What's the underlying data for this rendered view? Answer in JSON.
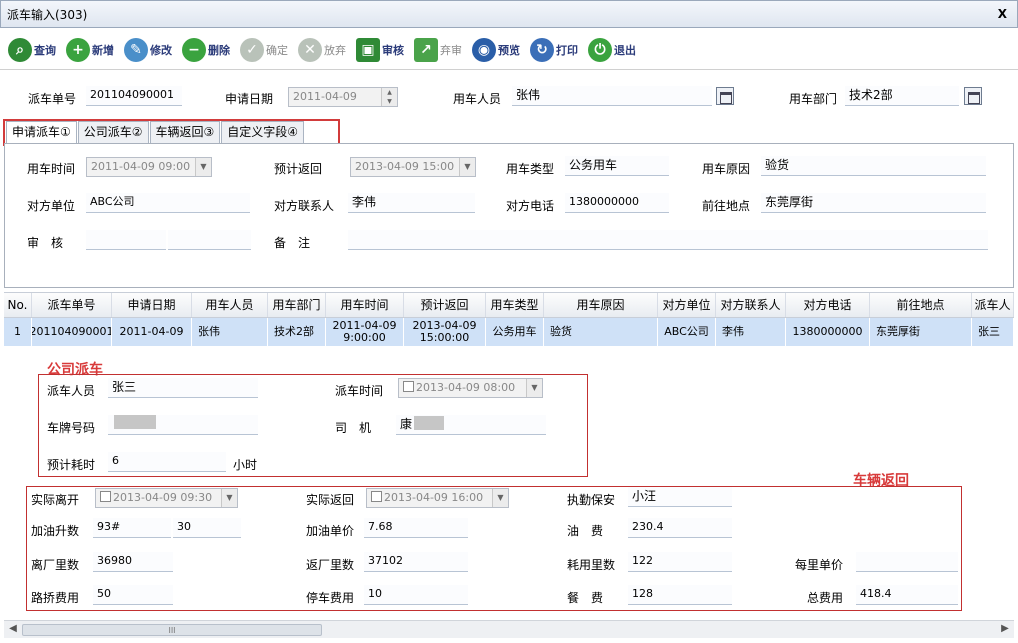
{
  "window": {
    "title": "派车输入(303)",
    "close": "X"
  },
  "toolbar": [
    {
      "name": "query",
      "label": "查询",
      "icon": "search-icon",
      "glyph": "⌕",
      "color": "#2f8a36",
      "enabled": true
    },
    {
      "name": "new",
      "label": "新增",
      "icon": "add-icon",
      "glyph": "+",
      "color": "#3aa33f",
      "enabled": true
    },
    {
      "name": "edit",
      "label": "修改",
      "icon": "pencil-icon",
      "glyph": "✎",
      "color": "#4a8fc9",
      "enabled": true
    },
    {
      "name": "delete",
      "label": "删除",
      "icon": "minus-icon",
      "glyph": "−",
      "color": "#3aa33f",
      "enabled": true
    },
    {
      "name": "confirm",
      "label": "确定",
      "icon": "check-icon",
      "glyph": "✓",
      "color": "#b9c2b9",
      "enabled": false
    },
    {
      "name": "abandon",
      "label": "放弃",
      "icon": "cancel-icon",
      "glyph": "✕",
      "color": "#b9c2b9",
      "enabled": false
    },
    {
      "name": "audit",
      "label": "审核",
      "icon": "audit-icon",
      "glyph": "▣",
      "color": "#2f8a36",
      "enabled": true
    },
    {
      "name": "unaudit",
      "label": "弃审",
      "icon": "unaudit-icon",
      "glyph": "↗",
      "color": "#4aa34a",
      "enabled": false
    },
    {
      "name": "preview",
      "label": "预览",
      "icon": "preview-icon",
      "glyph": "◉",
      "color": "#2a5ea8",
      "enabled": true
    },
    {
      "name": "print",
      "label": "打印",
      "icon": "print-icon",
      "glyph": "↻",
      "color": "#3b6fb8",
      "enabled": true
    },
    {
      "name": "exit",
      "label": "退出",
      "icon": "exit-icon",
      "glyph": "⏻",
      "color": "#3aa33f",
      "enabled": true
    }
  ],
  "header": {
    "order_no_label": "派车单号",
    "order_no": "201104090001",
    "apply_date_label": "申请日期",
    "apply_date": "2011-04-09",
    "user_label": "用车人员",
    "user": "张伟",
    "dept_label": "用车部门",
    "dept": "技术2部"
  },
  "tabs": [
    "申请派车①",
    "公司派车②",
    "车辆返回③",
    "自定义字段④"
  ],
  "apply": {
    "use_time_label": "用车时间",
    "use_time": "2011-04-09 09:00",
    "expect_return_label": "预计返回",
    "expect_return": "2013-04-09 15:00",
    "car_type_label": "用车类型",
    "car_type": "公务用车",
    "reason_label": "用车原因",
    "reason": "验货",
    "party_unit_label": "对方单位",
    "party_unit": "ABC公司",
    "party_contact_label": "对方联系人",
    "party_contact": "李伟",
    "party_phone_label": "对方电话",
    "party_phone": "1380000000",
    "destination_label": "前往地点",
    "destination": "东莞厚街",
    "auditor_label": "审　核",
    "remark_label": "备　注"
  },
  "grid": {
    "columns": [
      "No.",
      "派车单号",
      "申请日期",
      "用车人员",
      "用车部门",
      "用车时间",
      "预计返回",
      "用车类型",
      "用车原因",
      "对方单位",
      "对方联系人",
      "对方电话",
      "前往地点",
      "派车人"
    ],
    "row": {
      "no": "1",
      "order_no": "201104090001",
      "apply_date": "2011-04-09",
      "user": "张伟",
      "dept": "技术2部",
      "use_time_d": "2011-04-09",
      "use_time_t": "9:00:00",
      "return_d": "2013-04-09",
      "return_t": "15:00:00",
      "car_type": "公务用车",
      "reason": "验货",
      "party_unit": "ABC公司",
      "party_contact": "李伟",
      "party_phone": "1380000000",
      "destination": "东莞厚街",
      "dispatcher": "张三"
    }
  },
  "company_dispatch": {
    "section_title": "公司派车",
    "dispatcher_label": "派车人员",
    "dispatcher": "张三",
    "dispatch_time_label": "派车时间",
    "dispatch_time": "2013-04-09 08:00",
    "plate_label": "车牌号码",
    "driver_label": "司　机",
    "driver_prefix": "康",
    "expect_hours_label": "预计耗时",
    "expect_hours": "6",
    "hours_unit": "小时"
  },
  "car_return": {
    "section_title": "车辆返回",
    "actual_leave_label": "实际离开",
    "actual_leave": "2013-04-09 09:30",
    "actual_return_label": "实际返回",
    "actual_return": "2013-04-09 16:00",
    "guard_label": "执勤保安",
    "guard": "小汪",
    "fuel_amount_label": "加油升数",
    "fuel_grade": "93#",
    "fuel_amount": "30",
    "fuel_price_label": "加油单价",
    "fuel_price": "7.68",
    "fuel_fee_label": "油　费",
    "fuel_fee": "230.4",
    "leave_km_label": "离厂里数",
    "leave_km": "36980",
    "return_km_label": "返厂里数",
    "return_km": "37102",
    "used_km_label": "耗用里数",
    "used_km": "122",
    "per_km_price_label": "每里单价",
    "per_km_price": "",
    "toll_label": "路挢费用",
    "toll": "50",
    "parking_label": "停车费用",
    "parking": "10",
    "meal_label": "餐　费",
    "meal": "128",
    "total_label": "总费用",
    "total": "418.4"
  },
  "scrollbar": {
    "thumb_grip": "III"
  }
}
